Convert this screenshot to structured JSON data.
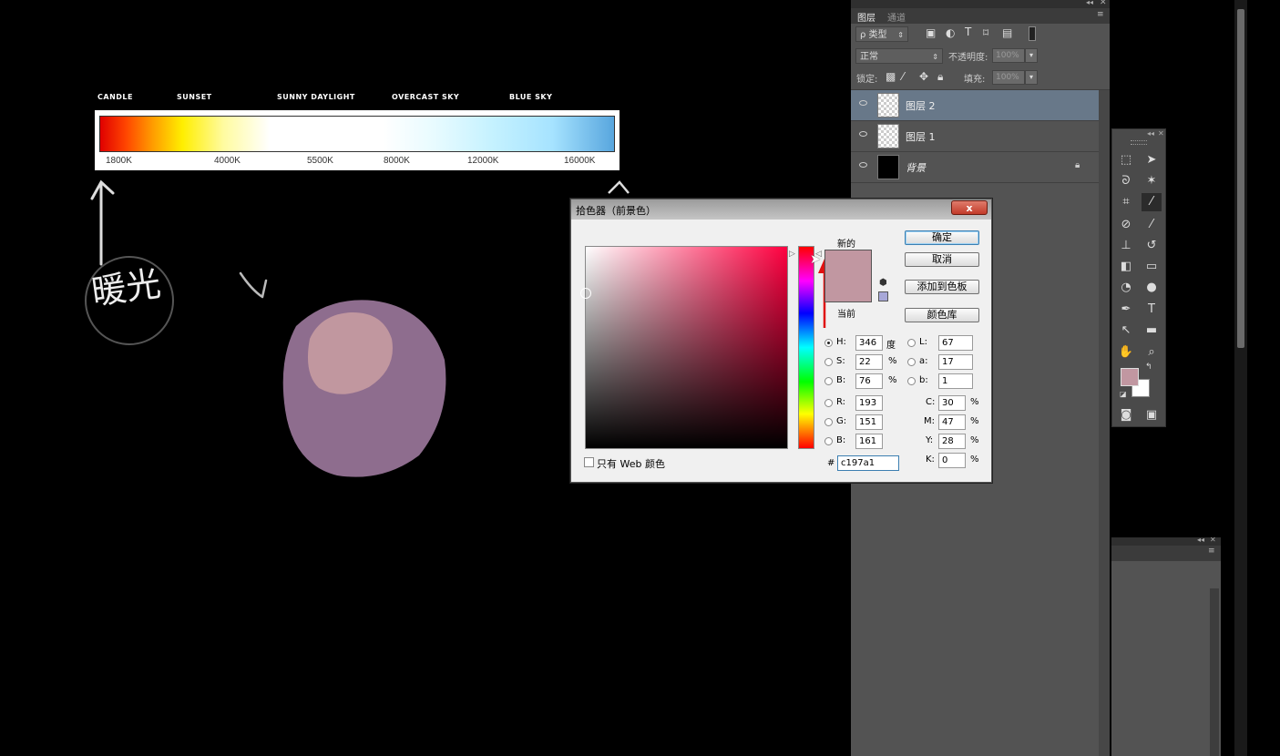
{
  "canvas": {
    "scale_labels": [
      "CANDLE",
      "SUNSET",
      "SUNNY DAYLIGHT",
      "OVERCAST SKY",
      "BLUE SKY"
    ],
    "ticks": [
      "1800K",
      "4000K",
      "5500K",
      "8000K",
      "12000K",
      "16000K"
    ],
    "handwriting": "暖光",
    "ball_color": "#8e6d8e",
    "highlight_color": "#c1979f"
  },
  "layers_panel": {
    "tabs": [
      "图层",
      "通道"
    ],
    "filter_label": "ρ 类型",
    "blend_mode": "正常",
    "opacity_label": "不透明度:",
    "opacity_value": "100%",
    "lock_label": "锁定:",
    "fill_label": "填充:",
    "fill_value": "100%",
    "layers": [
      {
        "name": "图层 2",
        "selected": true
      },
      {
        "name": "图层 1",
        "selected": false
      },
      {
        "name": "背景",
        "selected": false,
        "locked": true
      }
    ]
  },
  "dialog": {
    "title": "拾色器（前景色）",
    "close": "x",
    "new_label": "新的",
    "current_label": "当前",
    "new_color": "#c197a1",
    "current_color": "#c197a1",
    "buttons": {
      "ok": "确定",
      "cancel": "取消",
      "add_swatch": "添加到色板",
      "libraries": "颜色库"
    },
    "hsb": [
      {
        "label": "H:",
        "value": "346",
        "unit": "度",
        "selected": true
      },
      {
        "label": "S:",
        "value": "22",
        "unit": "%",
        "selected": false
      },
      {
        "label": "B:",
        "value": "76",
        "unit": "%",
        "selected": false
      }
    ],
    "rgb": [
      {
        "label": "R:",
        "value": "193"
      },
      {
        "label": "G:",
        "value": "151"
      },
      {
        "label": "B:",
        "value": "161"
      }
    ],
    "lab": [
      {
        "label": "L:",
        "value": "67"
      },
      {
        "label": "a:",
        "value": "17"
      },
      {
        "label": "b:",
        "value": "1"
      }
    ],
    "cmyk": [
      {
        "label": "C:",
        "value": "30",
        "unit": "%"
      },
      {
        "label": "M:",
        "value": "47",
        "unit": "%"
      },
      {
        "label": "Y:",
        "value": "28",
        "unit": "%"
      },
      {
        "label": "K:",
        "value": "0",
        "unit": "%"
      }
    ],
    "hex_label": "#",
    "hex_value": "c197a1",
    "web_only_label": "只有 Web 颜色"
  }
}
